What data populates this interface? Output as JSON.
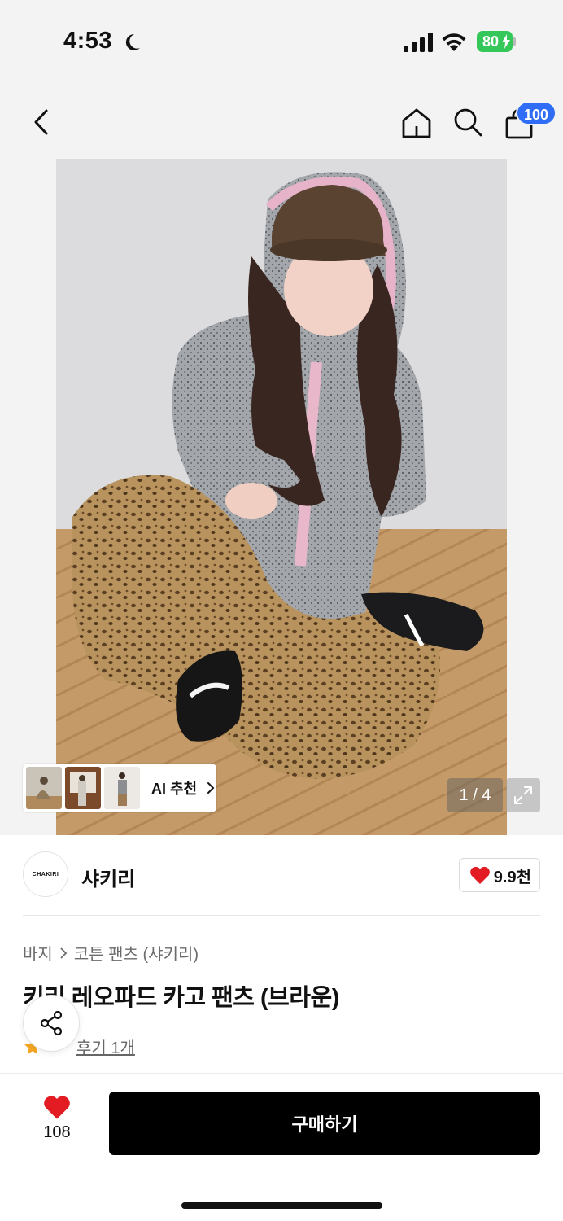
{
  "status_bar": {
    "time": "4:53",
    "battery_percent": "80"
  },
  "nav": {
    "back_icon": "chevron-left-icon",
    "home_icon": "home-icon",
    "search_icon": "search-icon",
    "cart_icon": "shopping-bag-icon",
    "cart_count": "100"
  },
  "gallery": {
    "page_indicator": "1 / 4",
    "ai_recommend_label": "AI 추천",
    "expand_icon": "expand-icon"
  },
  "brand": {
    "logo_text": "CHAKIRI",
    "name": "샤키리",
    "like_count": "9.9천"
  },
  "product": {
    "breadcrumb": [
      "바지",
      "코튼 팬츠 (샤키리)"
    ],
    "title": "키리 레오파드 카고 팬츠 (브라운)",
    "review_link": "후기 1개"
  },
  "bottom_bar": {
    "wish_count": "108",
    "buy_label": "구매하기"
  },
  "colors": {
    "accent_blue": "#2f6df6",
    "battery_green": "#34c759",
    "heart_red": "#e31b23",
    "star_orange": "#f5a623",
    "buy_button": "#000000"
  }
}
